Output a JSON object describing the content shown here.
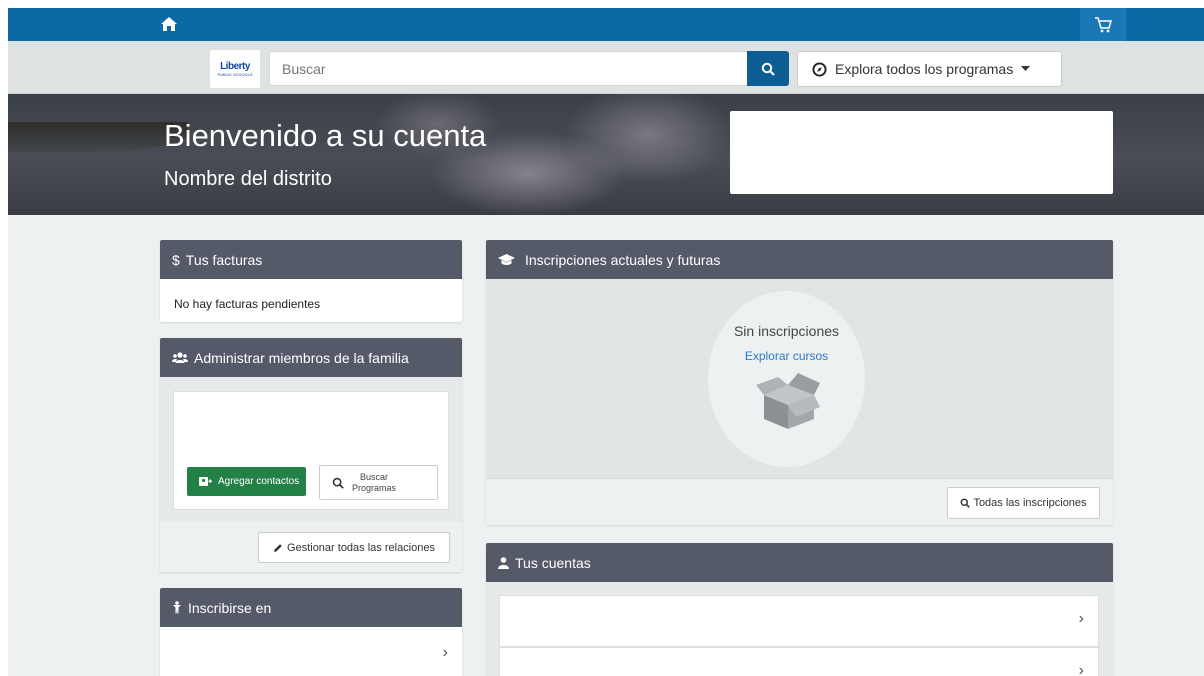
{
  "topbar": {
    "home_icon": "home-icon",
    "cart_icon": "cart-icon"
  },
  "search": {
    "placeholder": "Buscar",
    "logo_text": "Liberty",
    "logo_sub": "PUBLIC SCHOOLS",
    "explore_label": "Explora todos los programas"
  },
  "hero": {
    "title": "Bienvenido a su cuenta",
    "subtitle": "Nombre del distrito"
  },
  "facturas": {
    "title": "Tus facturas",
    "empty": "No hay facturas pendientes"
  },
  "familia": {
    "title": "Administrar miembros de la familia",
    "add_label": "Agregar contactos",
    "search_label_1": "Buscar",
    "search_label_2": "Programas",
    "manage_label": "Gestionar todas las relaciones"
  },
  "inscribir": {
    "title": "Inscribirse en"
  },
  "inscripciones": {
    "title": "Inscripciones actuales y futuras",
    "empty_title": "Sin inscripciones",
    "explore_link": "Explorar cursos",
    "all_label": "Todas las inscripciones"
  },
  "cuentas": {
    "title": "Tus cuentas"
  },
  "colors": {
    "brand_blue": "#0d69a6",
    "panel_header": "#545a68",
    "add_green": "#238046",
    "link_blue": "#2c7ac2"
  }
}
